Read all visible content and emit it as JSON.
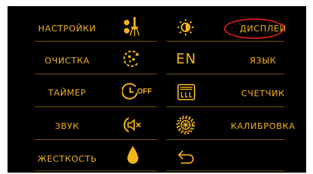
{
  "menu": {
    "left": [
      {
        "label": "НАСТРОЙКИ",
        "icon": "settings-icon"
      },
      {
        "label": "ОЧИСТКА",
        "icon": "cleaning-icon"
      },
      {
        "label": "ТАЙМЕР",
        "icon": "timer-off-icon",
        "icon_text": "OFF"
      },
      {
        "label": "ЗВУК",
        "icon": "sound-off-icon"
      },
      {
        "label": "ЖЕСТКОСТЬ",
        "icon": "water-drop-icon"
      }
    ],
    "right": [
      {
        "label": "ДИСПЛЕЙ",
        "icon": "brightness-icon",
        "highlighted": true
      },
      {
        "label": "ЯЗЫК",
        "icon": "language-icon",
        "icon_text": "EN"
      },
      {
        "label": "СЧЕТЧИК",
        "icon": "counter-icon"
      },
      {
        "label": "КАЛИБРОВКА",
        "icon": "calibration-gear-icon"
      },
      {
        "label": "",
        "icon": "back-arrow-icon"
      }
    ]
  },
  "colors": {
    "background": "#000000",
    "accent": "#f3b21a",
    "divider": "#7a5a14",
    "highlight_oval": "#d91e1e"
  }
}
